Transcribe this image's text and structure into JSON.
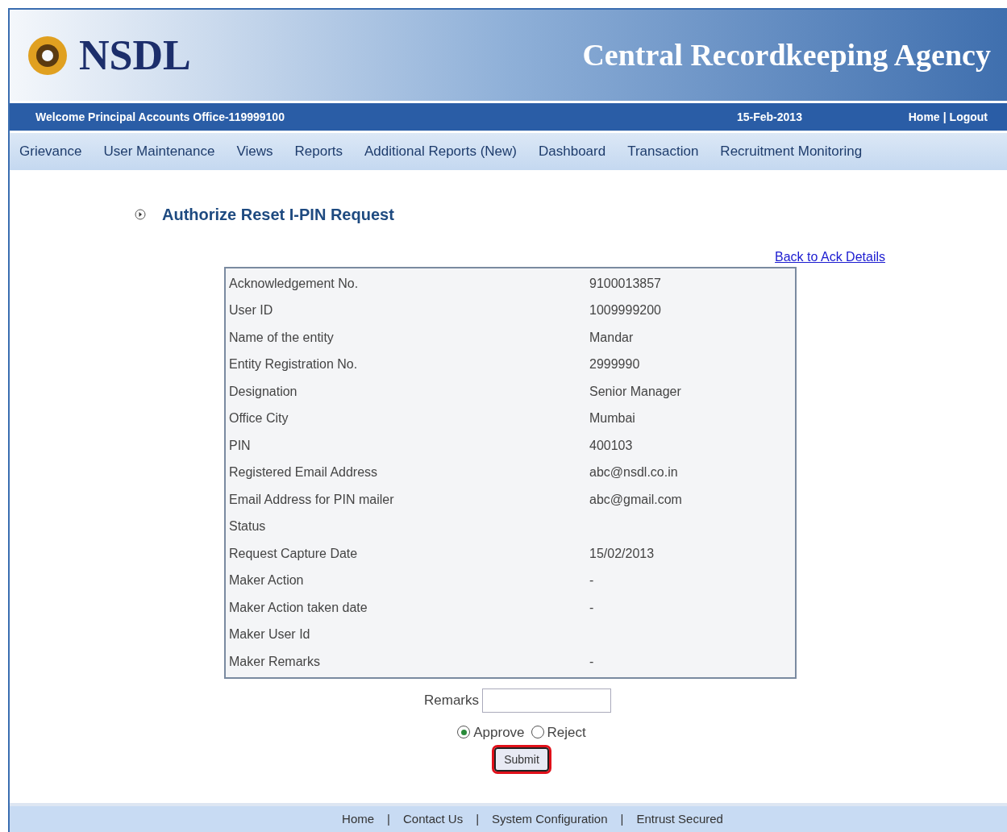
{
  "header": {
    "logo_text": "NSDL",
    "agency": "Central Recordkeeping Agency"
  },
  "info_bar": {
    "welcome": "Welcome Principal Accounts Office-119999100",
    "date": "15-Feb-2013",
    "links": [
      "Home",
      "Logout"
    ],
    "separator": "|"
  },
  "nav": [
    "Grievance",
    "User Maintenance",
    "Views",
    "Reports",
    "Additional Reports (New)",
    "Dashboard",
    "Transaction",
    "Recruitment Monitoring"
  ],
  "page_title": "Authorize Reset I-PIN Request",
  "back_link": "Back to Ack Details",
  "details": [
    {
      "label": "Acknowledgement No.",
      "value": "9100013857"
    },
    {
      "label": "User ID",
      "value": "1009999200"
    },
    {
      "label": "Name of the entity",
      "value": "Mandar"
    },
    {
      "label": "Entity Registration No.",
      "value": "2999990"
    },
    {
      "label": "Designation",
      "value": "Senior Manager"
    },
    {
      "label": "Office City",
      "value": "Mumbai"
    },
    {
      "label": "PIN",
      "value": "400103"
    },
    {
      "label": "Registered Email Address",
      "value": "abc@nsdl.co.in"
    },
    {
      "label": "Email Address for PIN mailer",
      "value": "abc@gmail.com"
    },
    {
      "label": "Status"
    },
    {
      "label": "Request Capture Date",
      "value": "15/02/2013"
    },
    {
      "label": "Maker Action",
      "value": "-"
    },
    {
      "label": "Maker Action taken date",
      "value": "-"
    },
    {
      "label": "Maker User Id"
    },
    {
      "label": "Maker Remarks",
      "value": "-"
    }
  ],
  "remarks": {
    "label": "Remarks"
  },
  "decision": [
    {
      "label": "Approve",
      "selected": true
    },
    {
      "label": "Reject",
      "selected": false
    }
  ],
  "submit": {
    "label": "Submit",
    "highlighted": true
  },
  "footer": {
    "links": [
      "Home",
      "Contact Us",
      "System Configuration",
      "Entrust Secured"
    ],
    "separator": "|"
  }
}
